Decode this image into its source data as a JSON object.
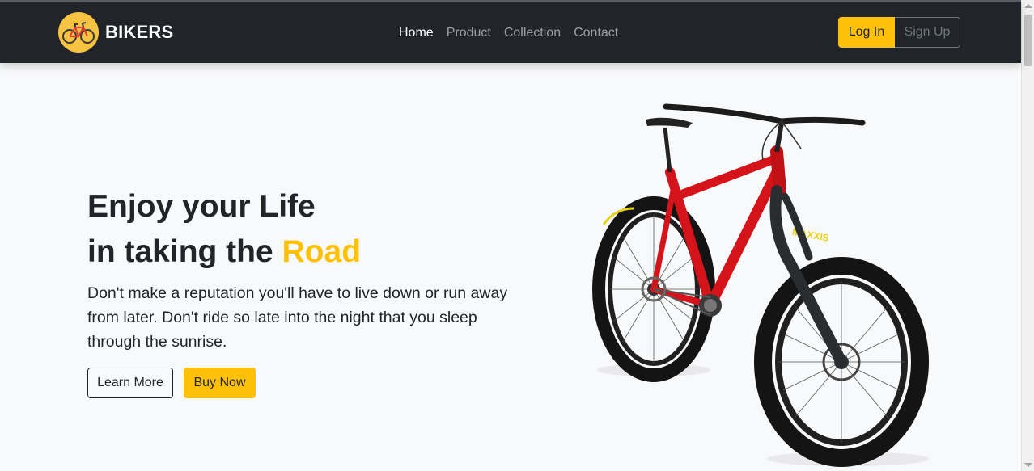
{
  "brand": {
    "name": "BIKERS",
    "logo_icon": "bicycle-logo-icon"
  },
  "nav": {
    "items": [
      {
        "label": "Home",
        "active": true
      },
      {
        "label": "Product",
        "active": false
      },
      {
        "label": "Collection",
        "active": false
      },
      {
        "label": "Contact",
        "active": false
      }
    ]
  },
  "auth": {
    "login_label": "Log In",
    "signup_label": "Sign Up"
  },
  "hero": {
    "headline_line1": "Enjoy your Life",
    "headline_line2_prefix": "in taking the ",
    "headline_line2_accent": "Road",
    "description": "Don't make a reputation you'll have to live down or run away from later. Don't ride so late into the night that you sleep through the sunrise.",
    "learn_more_label": "Learn More",
    "buy_now_label": "Buy Now",
    "tire_brand": "MAXXIS"
  },
  "colors": {
    "accent": "#ffc107",
    "navbar": "#212529",
    "background": "#f8f9fa",
    "bike_frame": "#d4141a"
  }
}
